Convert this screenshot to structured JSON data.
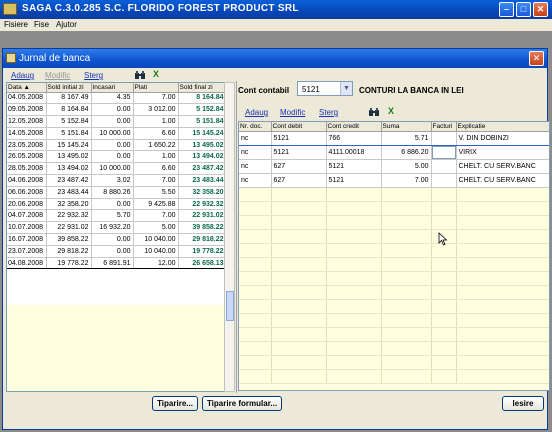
{
  "window": {
    "title": "SAGA C.3.0.285   S.C. FLORIDO FOREST PRODUCT SRL"
  },
  "menu": [
    "Fisiere",
    "Fise",
    "Ajutor"
  ],
  "dialog": {
    "title": "Jurnal de banca"
  },
  "left_toolbar": {
    "add": "Adaug",
    "modify": "Modific",
    "delete": "Sterg"
  },
  "left_table": {
    "columns": [
      "Data ▲",
      "Sold initial zi",
      "Incasari",
      "Plati",
      "Sold final zi"
    ],
    "rows": [
      [
        "04.05.2008",
        "8 167.49",
        "4.35",
        "7.00",
        "8 164.84"
      ],
      [
        "09.05.2008",
        "8 164.84",
        "0.00",
        "3 012.00",
        "5 152.84"
      ],
      [
        "12.05.2008",
        "5 152.84",
        "0.00",
        "1.00",
        "5 151.84"
      ],
      [
        "14.05.2008",
        "5 151.84",
        "10 000.00",
        "6.60",
        "15 145.24"
      ],
      [
        "23.05.2008",
        "15 145.24",
        "0.00",
        "1 650.22",
        "13 495.02"
      ],
      [
        "26.05.2008",
        "13 495.02",
        "0.00",
        "1.00",
        "13 494.02"
      ],
      [
        "28.05.2008",
        "13 494.02",
        "10 000.00",
        "6.60",
        "23 487.42"
      ],
      [
        "04.06.2008",
        "23 487.42",
        "3.02",
        "7.00",
        "23 483.44"
      ],
      [
        "06.06.2008",
        "23 483.44",
        "8 880.26",
        "5.50",
        "32 358.20"
      ],
      [
        "20.06.2008",
        "32 358.20",
        "0.00",
        "9 425.88",
        "22 932.32"
      ],
      [
        "04.07.2008",
        "22 932.32",
        "5.70",
        "7.00",
        "22 931.02"
      ],
      [
        "10.07.2008",
        "22 931.02",
        "16 932.20",
        "5.00",
        "39 858.22"
      ],
      [
        "16.07.2008",
        "39 858.22",
        "0.00",
        "10 040.00",
        "29 818.22"
      ],
      [
        "23.07.2008",
        "29 818.22",
        "0.00",
        "10 040.00",
        "19 778.22"
      ],
      [
        "04.08.2008",
        "19 778.22",
        "6 891.91",
        "12.00",
        "26 658.13"
      ]
    ]
  },
  "right_header": {
    "label": "Cont contabil",
    "account": "5121",
    "title": "CONTURI LA BANCA IN LEI"
  },
  "right_toolbar": {
    "add": "Adaug",
    "modify": "Modific",
    "delete": "Sterg"
  },
  "right_table": {
    "columns": [
      "Nr. doc.",
      "Cont debit",
      "Cont credit",
      "Suma",
      "Facturi",
      "Explicatie"
    ],
    "rows": [
      [
        "nc",
        "5121",
        "766",
        "5.71",
        "",
        "V. DIN DOBINZI"
      ],
      [
        "nc",
        "5121",
        "4111.00018",
        "6 886.20",
        "",
        "VIRIX"
      ],
      [
        "nc",
        "627",
        "5121",
        "5.00",
        "",
        "CHELT. CU SERV.BANC"
      ],
      [
        "nc",
        "627",
        "5121",
        "7.00",
        "",
        "CHELT. CU SERV.BANC"
      ]
    ]
  },
  "buttons": {
    "print": "Tiparire...",
    "print_form": "Tiparire formular...",
    "exit": "Iesire"
  }
}
